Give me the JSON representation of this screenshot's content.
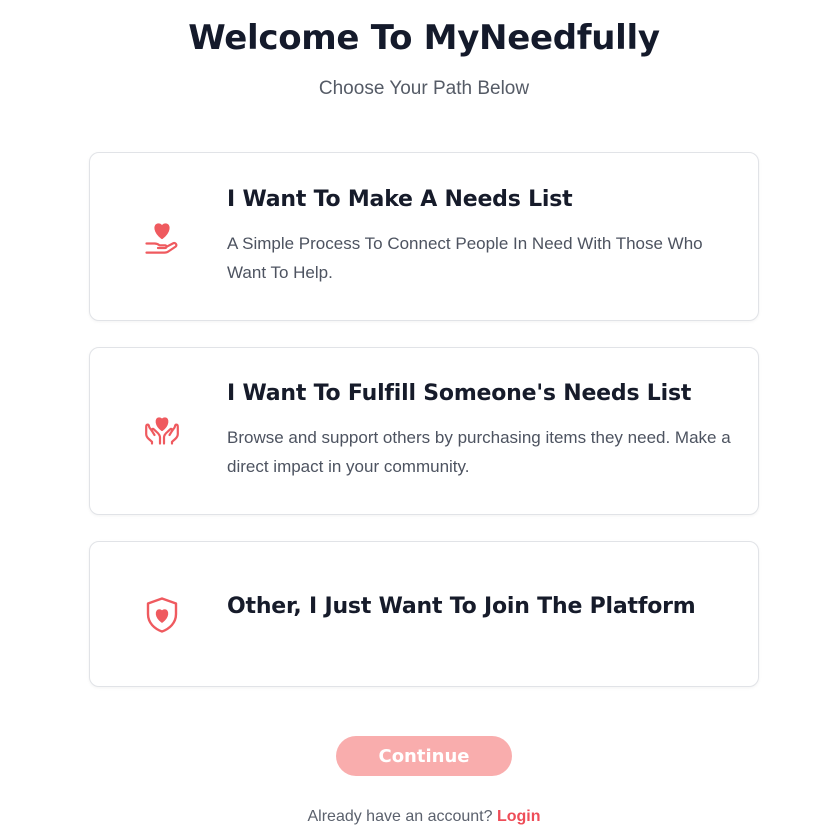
{
  "header": {
    "title": "Welcome To MyNeedfully",
    "subtitle": "Choose Your Path Below"
  },
  "options": [
    {
      "icon": "hand-heart-icon",
      "title": "I Want To Make A Needs List",
      "description": "A Simple Process To Connect People In Need With Those Who Want To Help."
    },
    {
      "icon": "hands-holding-heart-icon",
      "title": "I Want To Fulfill Someone's Needs List",
      "description": "Browse and support others by purchasing items they need. Make a direct impact in your community."
    },
    {
      "icon": "shield-heart-icon",
      "title": "Other, I Just Want To Join The Platform",
      "description": ""
    }
  ],
  "actions": {
    "continue_label": "Continue",
    "login_prompt": "Already have an account?",
    "login_label": "Login"
  },
  "colors": {
    "accent": "#ee4d58",
    "icon": "#ef5a5f",
    "continue_disabled_bg": "#f9adad",
    "card_border": "#e1e3e7",
    "heading_text": "#161b2a",
    "body_text": "#4d5360"
  }
}
